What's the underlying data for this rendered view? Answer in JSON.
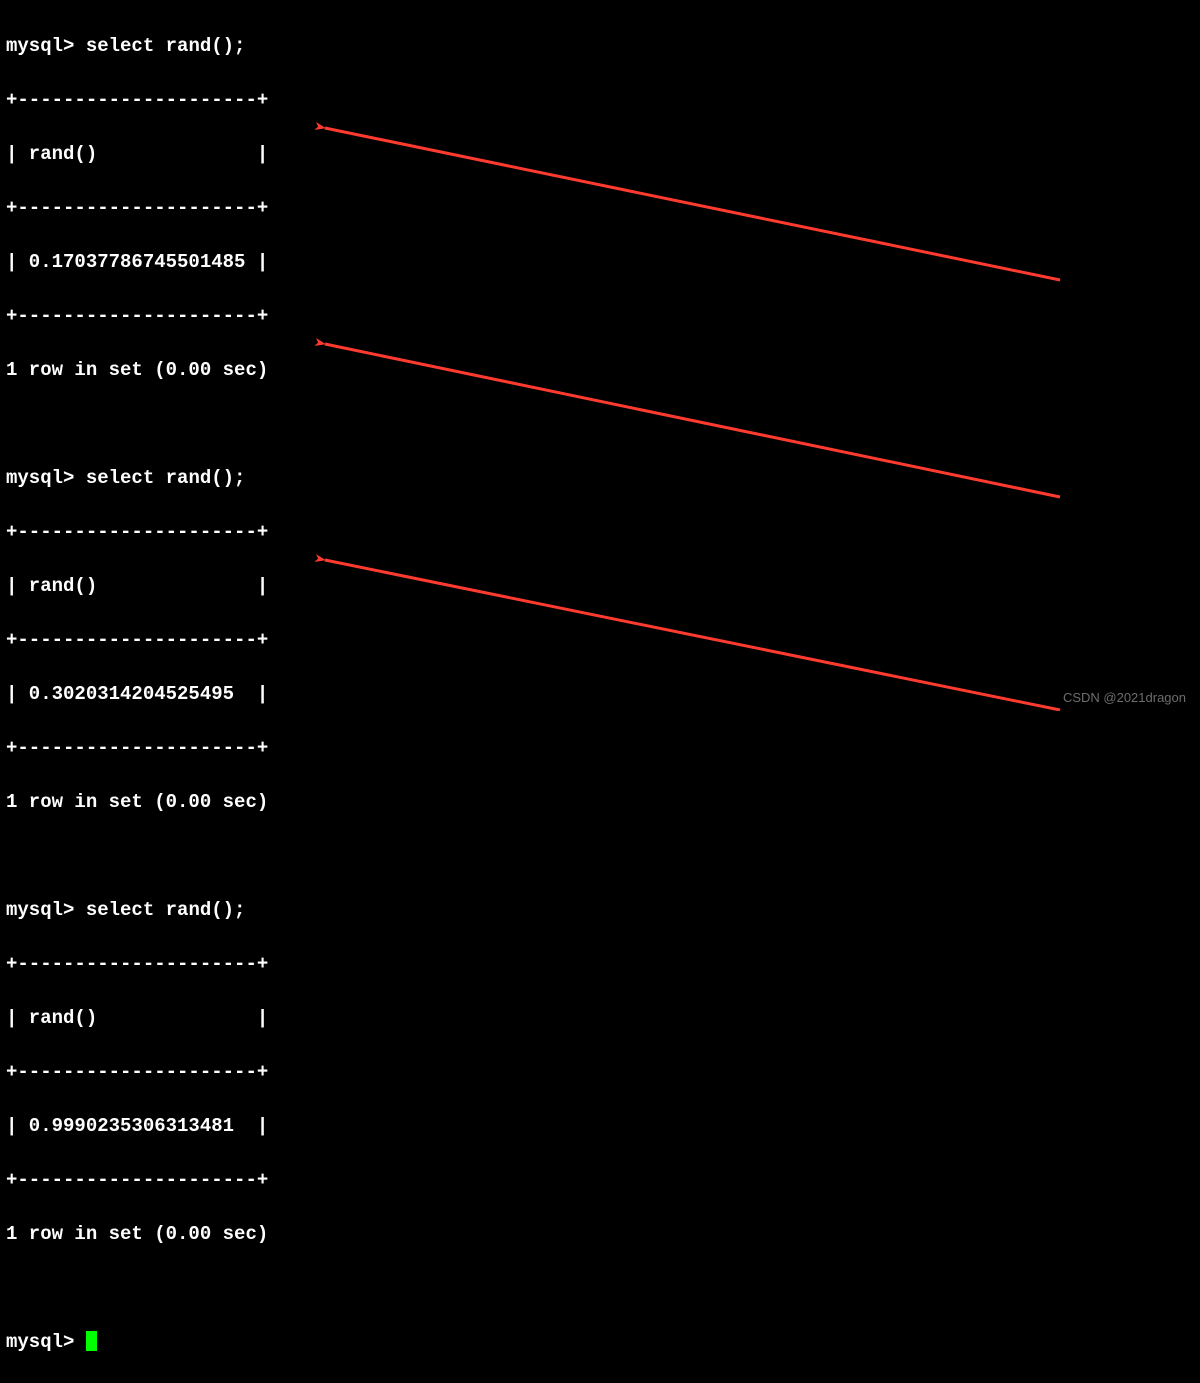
{
  "terminal": {
    "prompt": "mysql>",
    "command": "select rand();",
    "divider": "+---------------------+",
    "column_header": "| rand()              |",
    "status": "1 row in set (0.00 sec)",
    "results": [
      "| 0.17037786745501485 |",
      "| 0.3020314204525495  |",
      "| 0.9990235306313481  |"
    ]
  },
  "watermark": "CSDN @2021dragon",
  "arrow_color": "#ff3b30"
}
